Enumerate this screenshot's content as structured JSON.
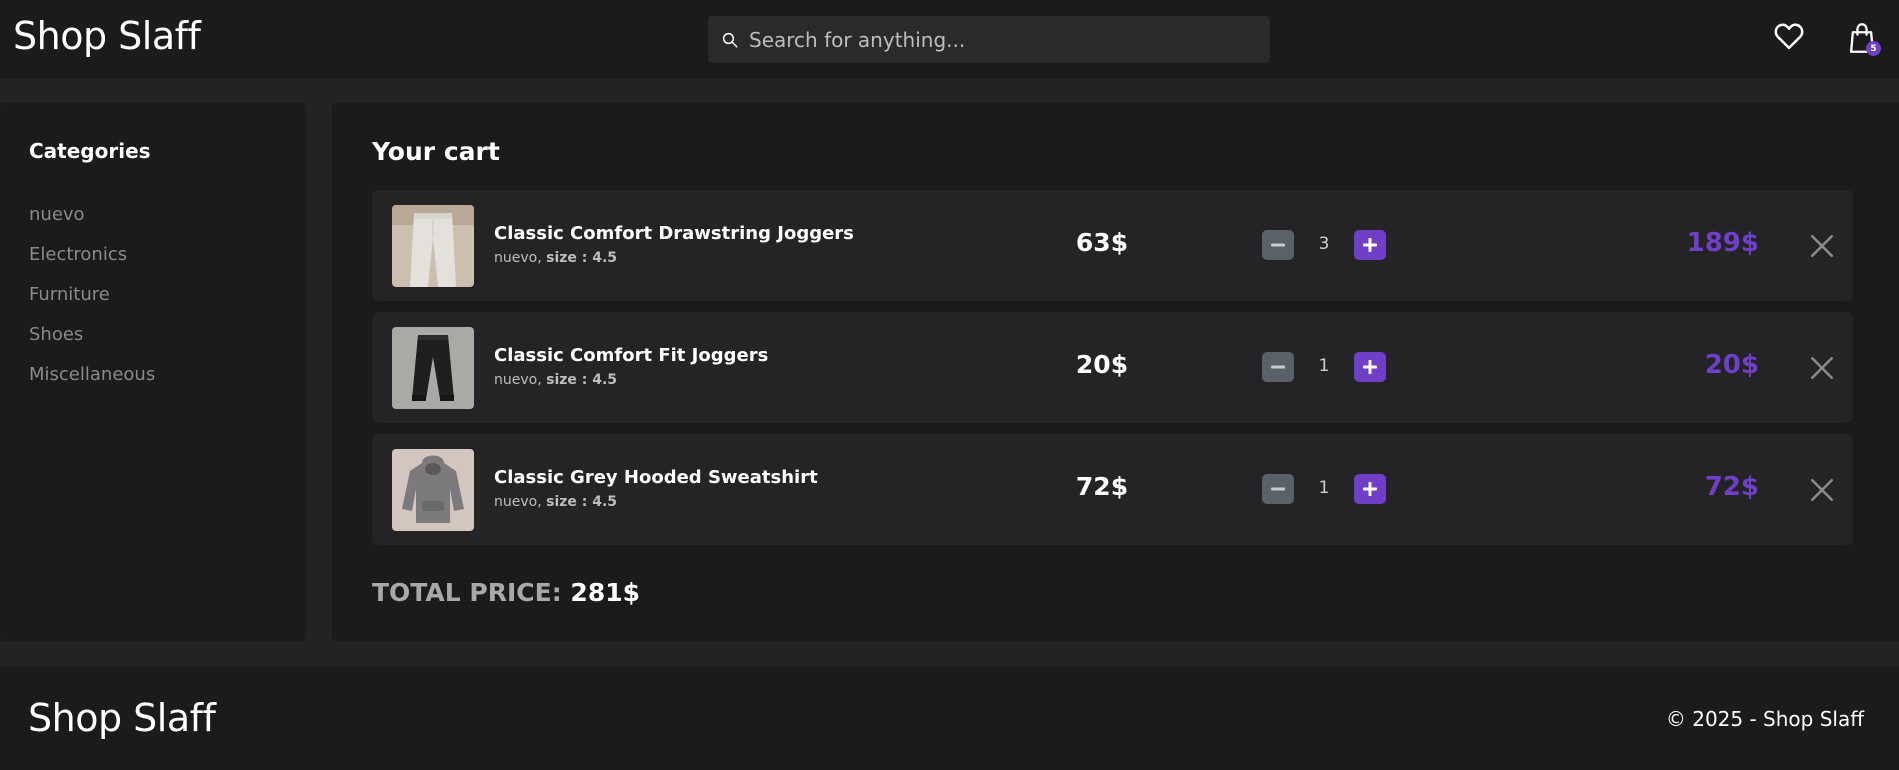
{
  "header": {
    "logo": "Shop Slaff",
    "search_placeholder": "Search for anything...",
    "search_value": "",
    "favorites_icon": "heart-icon",
    "cart_icon": "shopping-bag-icon",
    "cart_badge": "5"
  },
  "sidebar": {
    "title": "Categories",
    "categories": [
      "nuevo",
      "Electronics",
      "Furniture",
      "Shoes",
      "Miscellaneous"
    ]
  },
  "cart": {
    "title": "Your cart",
    "items": [
      {
        "name": "Classic Comfort Drawstring Joggers",
        "category": "nuevo,",
        "size_label": "size : 4.5",
        "unit_price": "63$",
        "quantity": "3",
        "line_total": "189$",
        "image": "light-grey-joggers"
      },
      {
        "name": "Classic Comfort Fit Joggers",
        "category": "nuevo,",
        "size_label": "size : 4.5",
        "unit_price": "20$",
        "quantity": "1",
        "line_total": "20$",
        "image": "black-joggers"
      },
      {
        "name": "Classic Grey Hooded Sweatshirt",
        "category": "nuevo,",
        "size_label": "size : 4.5",
        "unit_price": "72$",
        "quantity": "1",
        "line_total": "72$",
        "image": "grey-hoodie"
      }
    ],
    "total_label": "TOTAL PRICE:",
    "total_value": "281$"
  },
  "footer": {
    "logo": "Shop Slaff",
    "copyright": "© 2025 - Shop Slaff"
  },
  "colors": {
    "background": "#232325",
    "panel": "#1b1b1c",
    "card": "#242426",
    "accent": "#6f3fc8",
    "muted_button": "#5b6169"
  }
}
